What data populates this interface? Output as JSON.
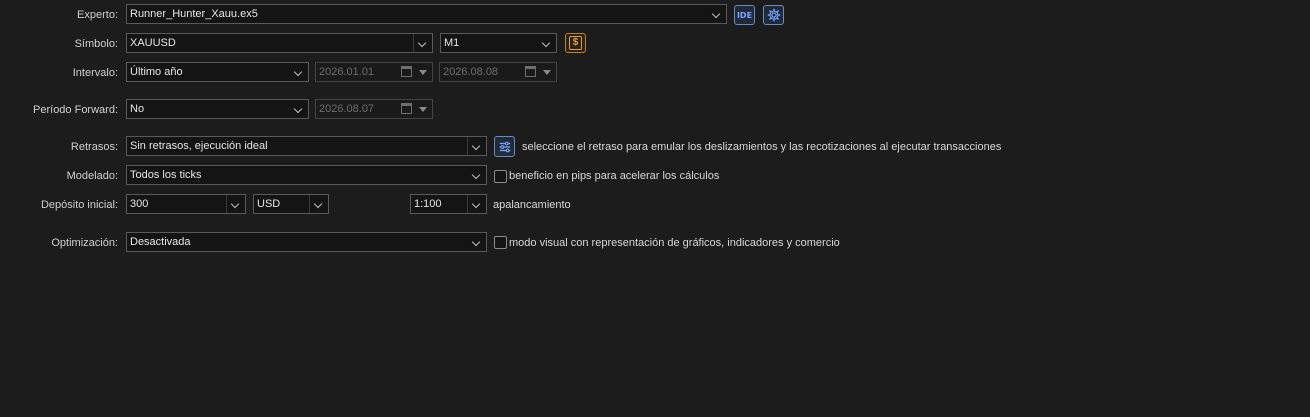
{
  "experto": {
    "label": "Experto:",
    "value": "Runner_Hunter_Xauu.ex5"
  },
  "simbolo": {
    "label": "Símbolo:",
    "value": "XAUUSD",
    "timeframe": "M1"
  },
  "intervalo": {
    "label": "Intervalo:",
    "value": "Último año",
    "from": "2026.01.01",
    "to": "2026.08.08"
  },
  "forward": {
    "label": "Período Forward:",
    "value": "No",
    "date": "2026.08.07"
  },
  "retrasos": {
    "label": "Retrasos:",
    "value": "Sin retrasos, ejecución ideal",
    "hint": "seleccione el retraso para emular los deslizamientos y las recotizaciones al ejecutar transacciones"
  },
  "modelado": {
    "label": "Modelado:",
    "value": "Todos los ticks",
    "checkbox_label": "beneficio en pips para acelerar los cálculos"
  },
  "deposito": {
    "label": "Depósito inicial:",
    "value": "300",
    "currency": "USD",
    "leverage": "1:100",
    "leverage_label": "apalancamiento"
  },
  "optimizacion": {
    "label": "Optimización:",
    "value": "Desactivada",
    "checkbox_label": "modo visual con representación de gráficos, indicadores y comercio"
  },
  "icons": {
    "ide": "ide-icon",
    "settings": "gear-icon",
    "symbol": "dollar-icon",
    "delay": "sliders-icon"
  },
  "colors": {
    "background": "#1c1c1c",
    "accent": "#5a86d6",
    "symbol_icon": "#d9902a"
  }
}
